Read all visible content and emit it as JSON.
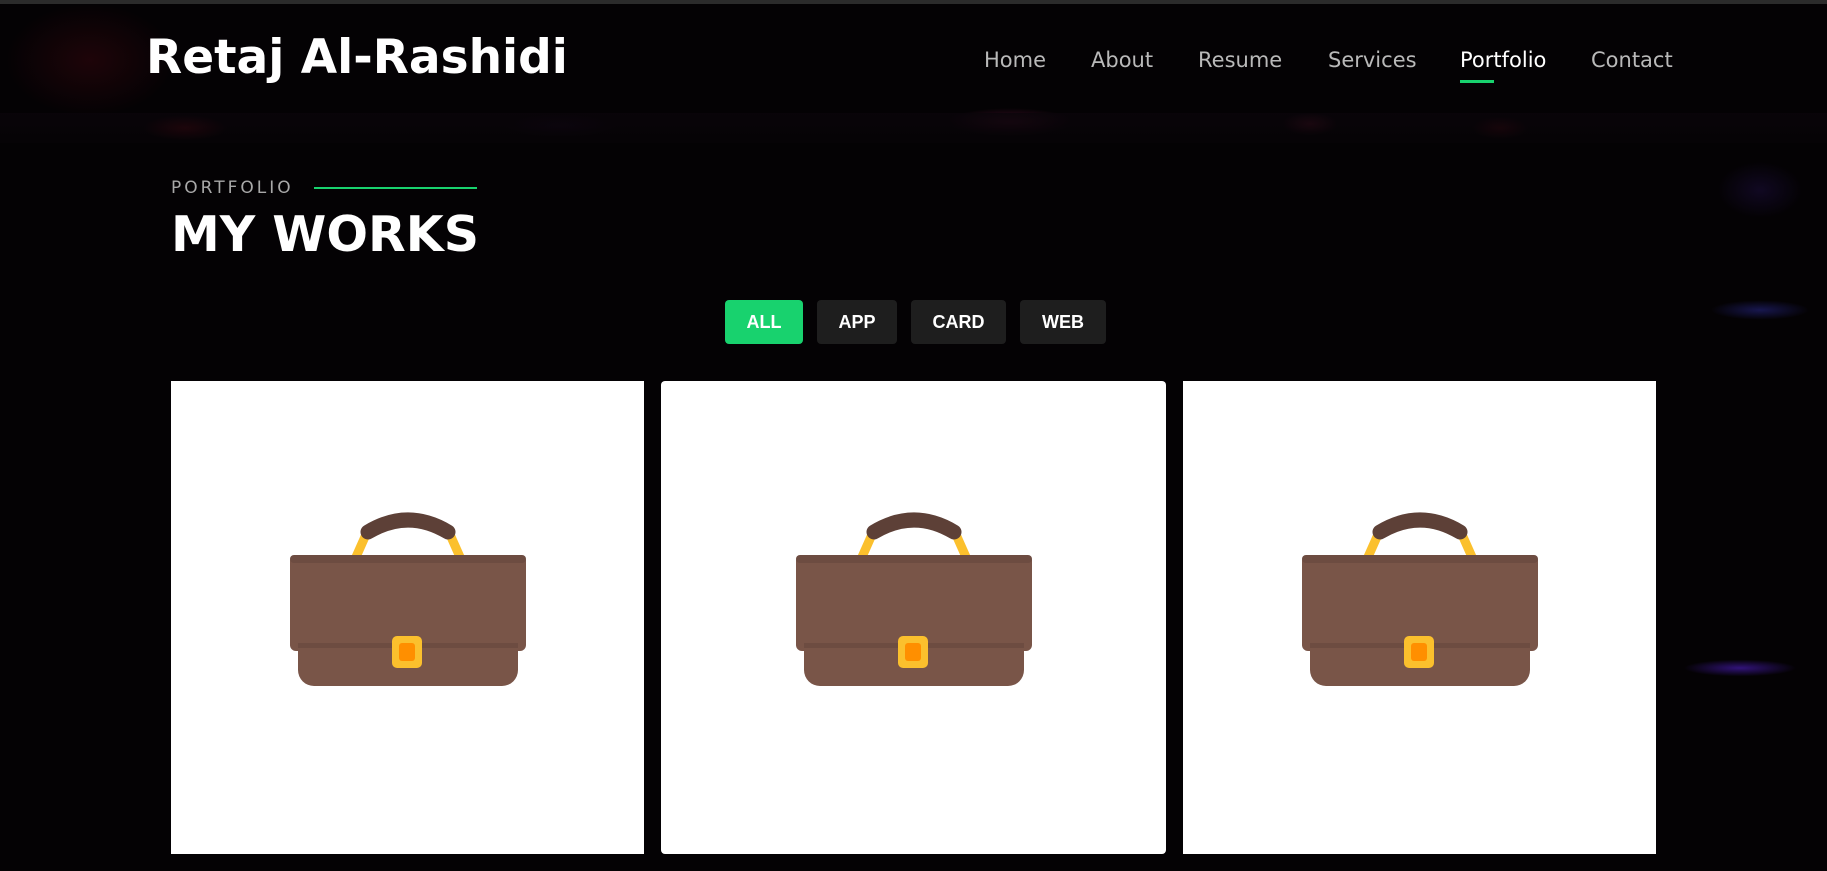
{
  "brand": {
    "name": "Retaj Al-Rashidi"
  },
  "nav": {
    "items": [
      {
        "label": "Home"
      },
      {
        "label": "About"
      },
      {
        "label": "Resume"
      },
      {
        "label": "Services"
      },
      {
        "label": "Portfolio"
      },
      {
        "label": "Contact"
      }
    ],
    "active": "Portfolio"
  },
  "section": {
    "subtitle": "PORTFOLIO",
    "title": "MY WORKS"
  },
  "filters": {
    "items": [
      {
        "label": "ALL"
      },
      {
        "label": "APP"
      },
      {
        "label": "CARD"
      },
      {
        "label": "WEB"
      }
    ],
    "active": "ALL"
  },
  "portfolio": {
    "items": [
      {
        "icon": "briefcase-icon"
      },
      {
        "icon": "briefcase-icon"
      },
      {
        "icon": "briefcase-icon"
      }
    ]
  },
  "colors": {
    "accent": "#18d26e",
    "background": "#040204",
    "filter_bg": "#1e1e1e",
    "bag_body": "#795548",
    "bag_handle": "#5d4037",
    "bag_strap": "#fbc02d",
    "bag_clasp": "#ffb300"
  }
}
